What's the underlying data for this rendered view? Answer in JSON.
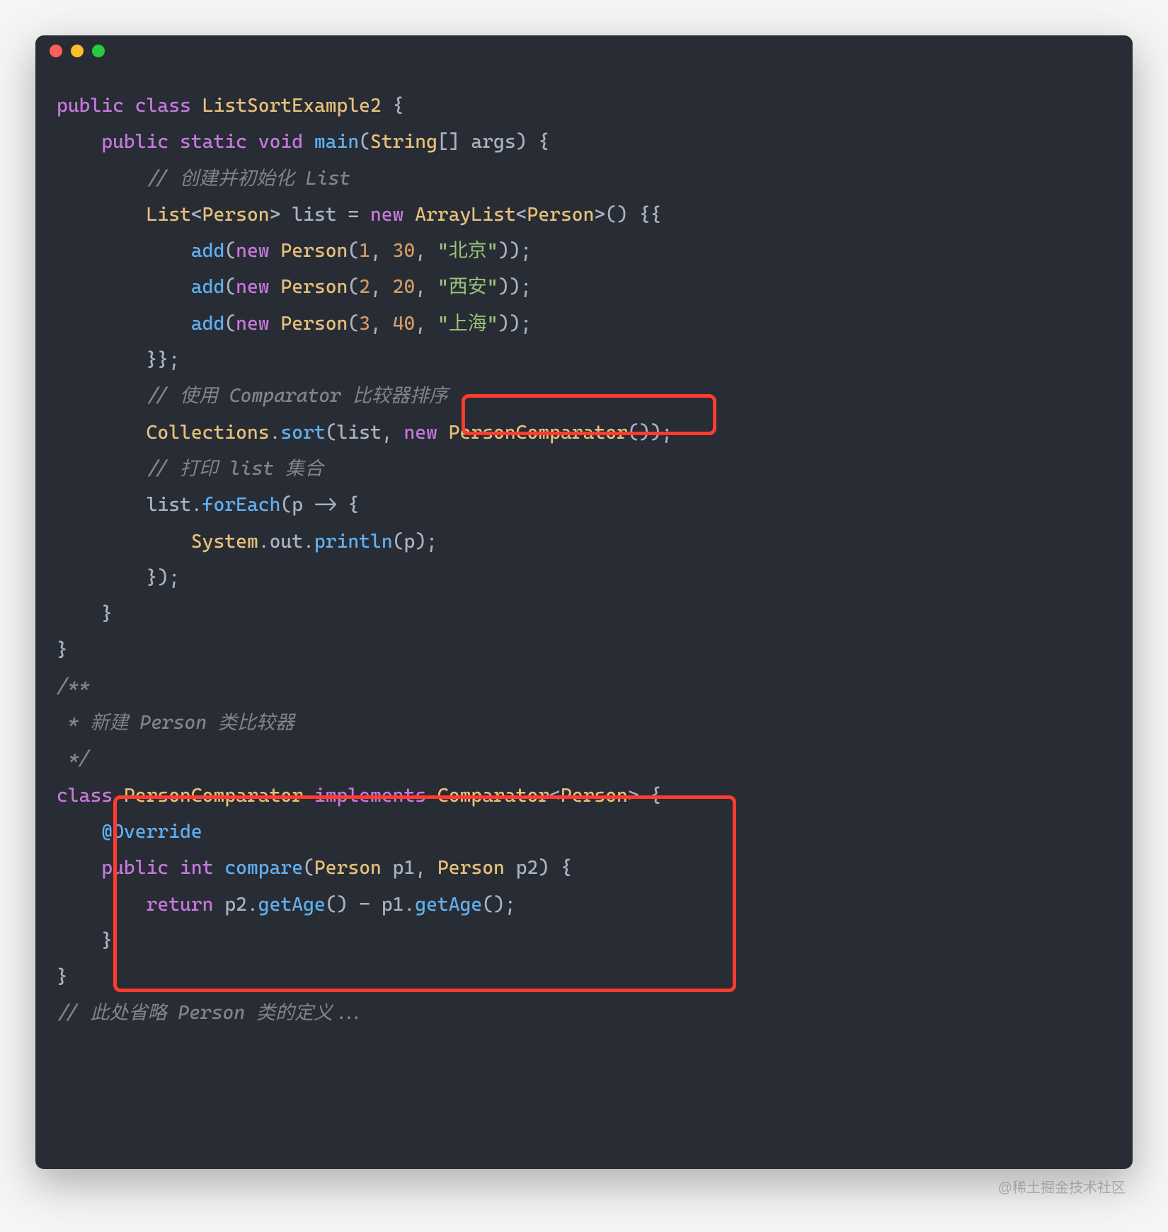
{
  "window": {
    "dots": [
      "red",
      "yellow",
      "green"
    ]
  },
  "code": {
    "kw_public": "public",
    "kw_class": "class",
    "kw_static": "static",
    "kw_void": "void",
    "kw_new": "new",
    "kw_return": "return",
    "kw_implements": "implements",
    "kw_int": "int",
    "cls_ListSortExample2": "ListSortExample2",
    "fn_main": "main",
    "type_String": "String",
    "type_List": "List",
    "type_Person": "Person",
    "type_ArrayList": "ArrayList",
    "type_Comparator": "Comparator",
    "var_args": "args",
    "var_list": "list",
    "var_p": "p",
    "var_p1": "p1",
    "var_p2": "p2",
    "fn_add": "add",
    "fn_sort": "sort",
    "fn_forEach": "forEach",
    "fn_println": "println",
    "fn_compare": "compare",
    "fn_getAge": "getAge",
    "cls_Collections": "Collections",
    "cls_System": "System",
    "fld_out": "out",
    "cls_PersonComparator": "PersonComparator",
    "ann_Override": "@Override",
    "cmt_init": "// 创建并初始化 List",
    "cmt_sort": "// 使用 Comparator 比较器排序",
    "cmt_print": "// 打印 list 集合",
    "cmt_doc1": "/**",
    "cmt_doc2": " * 新建 Person 类比较器",
    "cmt_doc3": " */",
    "cmt_omit": "// 此处省略 Person 类的定义...",
    "num_1": "1",
    "num_2": "2",
    "num_3": "3",
    "num_30": "30",
    "num_20": "20",
    "num_40": "40",
    "str_bj": "\"北京\"",
    "str_xa": "\"西安\"",
    "str_sh": "\"上海\""
  },
  "watermark": "@稀土掘金技术社区"
}
